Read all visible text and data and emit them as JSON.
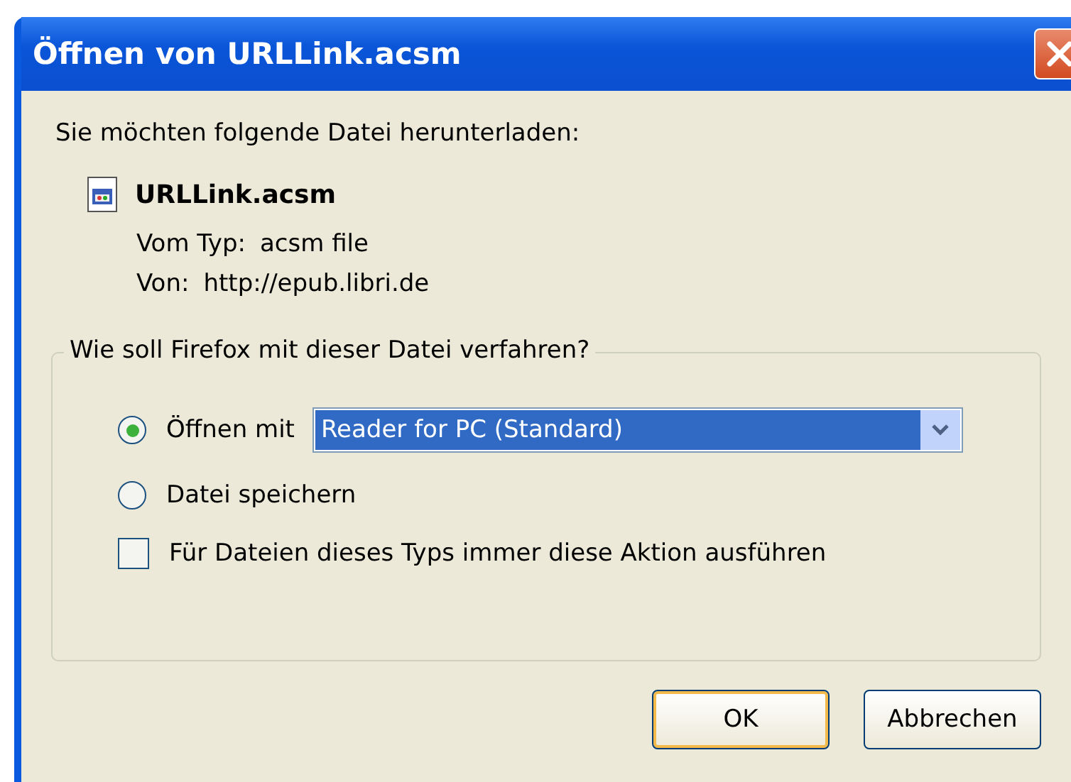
{
  "window": {
    "title": "Öffnen von URLLink.acsm"
  },
  "intro": "Sie möchten folgende Datei herunterladen:",
  "file": {
    "name": "URLLink.acsm",
    "details": [
      {
        "label": "Vom Typ:",
        "value": "acsm file"
      },
      {
        "label": "Von:",
        "value": "http://epub.libri.de"
      }
    ]
  },
  "group": {
    "legend": "Wie soll Firefox mit dieser Datei verfahren?",
    "options": [
      {
        "kind": "open",
        "label": "Öffnen mit",
        "selected": true,
        "app": "Reader for PC (Standard)"
      },
      {
        "kind": "save",
        "label": "Datei speichern",
        "selected": false
      }
    ],
    "remember": {
      "label": "Für Dateien dieses Typs immer diese Aktion ausführen",
      "checked": false
    }
  },
  "buttons": [
    {
      "label": "OK",
      "default": true
    },
    {
      "label": "Abbrechen",
      "default": false
    }
  ]
}
